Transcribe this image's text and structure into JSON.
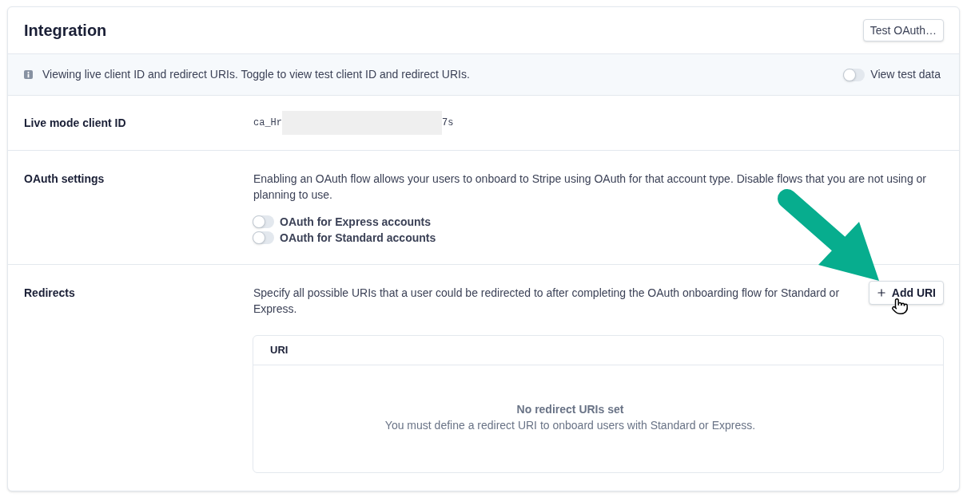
{
  "header": {
    "title": "Integration",
    "button": "Test OAuth…"
  },
  "notice": {
    "text": "Viewing live client ID and redirect URIs. Toggle to view test client ID and redirect URIs.",
    "toggle": {
      "label": "View test data",
      "on": false
    }
  },
  "client_id": {
    "label": "Live mode client ID",
    "value_start": "ca_Hr",
    "value_end": "7s",
    "redacted": true
  },
  "oauth_settings": {
    "label": "OAuth settings",
    "description": "Enabling an OAuth flow allows your users to onboard to Stripe using OAuth for that account type. Disable flows that you are not using or planning to use.",
    "toggles": [
      {
        "label": "OAuth for Express accounts",
        "on": false
      },
      {
        "label": "OAuth for Standard accounts",
        "on": false
      }
    ]
  },
  "redirects": {
    "label": "Redirects",
    "description": "Specify all possible URIs that a user could be redirected to after completing the OAuth onboarding flow for Standard or Express.",
    "button": "Add URI",
    "table": {
      "columns": [
        "URI"
      ],
      "empty_title": "No redirect URIs set",
      "empty_message": "You must define a redirect URI to onboard users with Standard or Express."
    }
  }
}
